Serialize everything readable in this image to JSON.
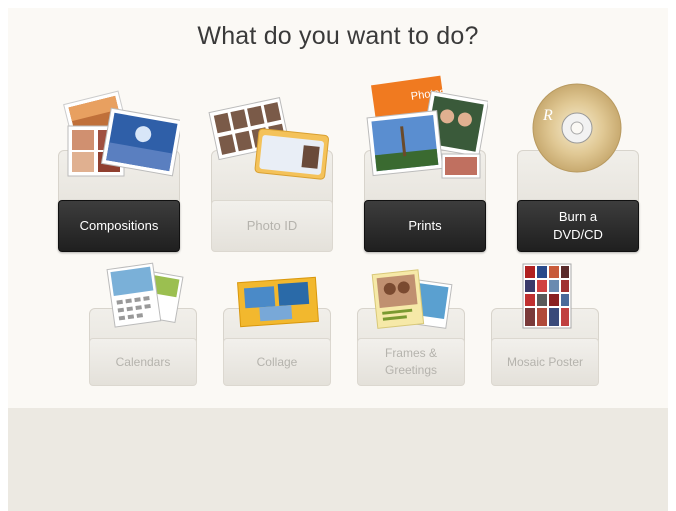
{
  "header": {
    "title": "What do you want to do?"
  },
  "options_row1": [
    {
      "label": "Compositions",
      "state": "enabled",
      "icon": "compositions-icon"
    },
    {
      "label": "Photo ID",
      "state": "disabled",
      "icon": "photo-id-icon"
    },
    {
      "label": "Prints",
      "state": "enabled",
      "icon": "prints-icon"
    },
    {
      "label": "Burn a\nDVD/CD",
      "state": "enabled",
      "icon": "disc-icon"
    }
  ],
  "options_row2": [
    {
      "label": "Calendars",
      "state": "disabled",
      "icon": "calendar-icon"
    },
    {
      "label": "Collage",
      "state": "disabled",
      "icon": "collage-icon"
    },
    {
      "label": "Frames &\nGreetings",
      "state": "disabled",
      "icon": "frames-icon"
    },
    {
      "label": "Mosaic Poster",
      "state": "disabled",
      "icon": "mosaic-icon"
    }
  ],
  "prints_art_text": "Photos",
  "disc_art_text": "R",
  "colors": {
    "enabled_button": "#2a2a2a",
    "disabled_text": "#b5b3ad",
    "panel": "#fbf9f5",
    "footer": "#ece9e2"
  }
}
